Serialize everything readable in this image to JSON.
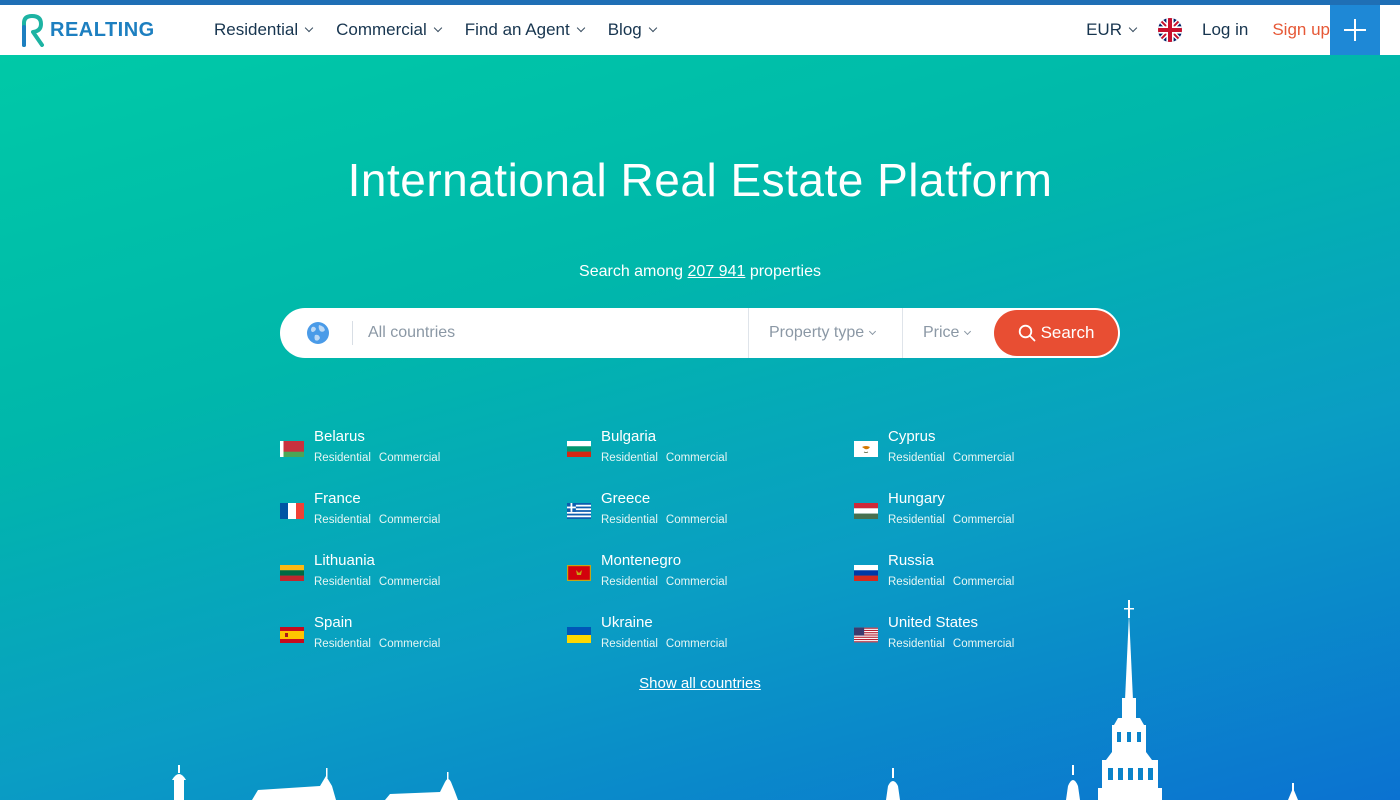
{
  "brand": {
    "name": "REALTING"
  },
  "nav": {
    "items": [
      {
        "label": "Residential"
      },
      {
        "label": "Commercial"
      },
      {
        "label": "Find an Agent"
      },
      {
        "label": "Blog"
      }
    ],
    "currency": "EUR",
    "login": "Log in",
    "signup": "Sign up"
  },
  "hero": {
    "title": "International Real Estate Platform",
    "subtitle_prefix": "Search among",
    "count": "207 941",
    "subtitle_suffix": "properties"
  },
  "search": {
    "placeholder": "All countries",
    "property_type": "Property type",
    "price": "Price",
    "button": "Search"
  },
  "countries": [
    {
      "name": "Belarus",
      "residential": "Residential",
      "commercial": "Commercial"
    },
    {
      "name": "Bulgaria",
      "residential": "Residential",
      "commercial": "Commercial"
    },
    {
      "name": "Cyprus",
      "residential": "Residential",
      "commercial": "Commercial"
    },
    {
      "name": "France",
      "residential": "Residential",
      "commercial": "Commercial"
    },
    {
      "name": "Greece",
      "residential": "Residential",
      "commercial": "Commercial"
    },
    {
      "name": "Hungary",
      "residential": "Residential",
      "commercial": "Commercial"
    },
    {
      "name": "Lithuania",
      "residential": "Residential",
      "commercial": "Commercial"
    },
    {
      "name": "Montenegro",
      "residential": "Residential",
      "commercial": "Commercial"
    },
    {
      "name": "Russia",
      "residential": "Residential",
      "commercial": "Commercial"
    },
    {
      "name": "Spain",
      "residential": "Residential",
      "commercial": "Commercial"
    },
    {
      "name": "Ukraine",
      "residential": "Residential",
      "commercial": "Commercial"
    },
    {
      "name": "United States",
      "residential": "Residential",
      "commercial": "Commercial"
    }
  ],
  "show_all": "Show all countries",
  "colors": {
    "accent": "#e84e33",
    "brand": "#1d7fc0",
    "plus": "#1e88d6"
  }
}
